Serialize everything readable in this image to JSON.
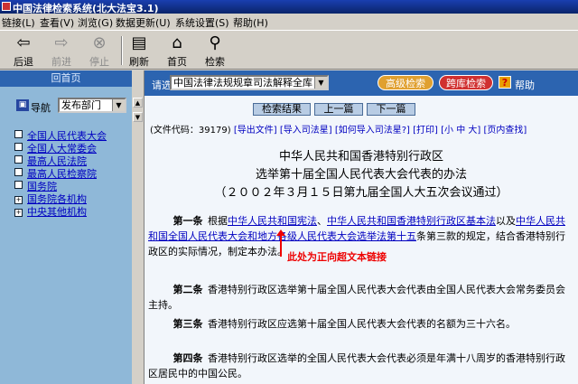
{
  "window": {
    "title": "中国法律检索系统(北大法宝3.1)"
  },
  "menu": [
    "链接(L)",
    "查看(V)",
    "浏览(G)",
    "数据更新(U)",
    "系统设置(S)",
    "帮助(H)"
  ],
  "toolbar": {
    "back": "后退",
    "forward": "前进",
    "stop": "停止",
    "refresh": "刷新",
    "home": "首页",
    "search": "检索"
  },
  "left": {
    "home_label": "回首页",
    "nav_label": "导航",
    "nav_select": "发布部门",
    "tree": [
      "全国人民代表大会",
      "全国人大常委会",
      "最高人民法院",
      "最高人民检察院",
      "国务院",
      "国务院各机构",
      "中央其他机构"
    ]
  },
  "query": {
    "label": "请选择",
    "select_value": "中国法律法规规章司法解释全库",
    "advanced": "高级检索",
    "cross": "跨库检索",
    "help": "帮助"
  },
  "doc": {
    "result_btn": "检索结果",
    "prev_btn": "上一篇",
    "next_btn": "下一篇",
    "code_text": "(文件代码：39179)",
    "links": [
      "[导出文件]",
      "[导入司法星]",
      "[如何导入司法星?]",
      "[打印]",
      "[小 中 大]",
      "[页内查找]"
    ],
    "title1": "中华人民共和国香港特别行政区",
    "title2": "选举第十届全国人民代表大会代表的办法",
    "title3": "（２００２年３月１５日第九届全国人大五次会议通过）",
    "a1_label": "第一条",
    "a1_pre": "根据",
    "a1_link1": "中华人民共和国宪法",
    "a1_sep1": "、",
    "a1_link2": "中华人民共和国香港特别行政区基本法",
    "a1_mid": "以及",
    "a1_link3": "中华人民共和国全国人民代表大会和地方各级人民代表大会选举法",
    "a1_link4": "第十五",
    "a1_post": "条第三款的规定，结合香港特别行政区的实际情况，制定本办法。",
    "annotation": "此处为正向超文本链接",
    "a2_label": "第二条",
    "a2_text": "香港特别行政区选举第十届全国人民代表大会代表由全国人民代表大会常务委员会主持。",
    "a3_label": "第三条",
    "a3_text": "香港特别行政区应选第十届全国人民代表大会代表的名额为三十六名。",
    "a4_label": "第四条",
    "a4_text": "香港特别行政区选举的全国人民代表大会代表必须是年满十八周岁的香港特别行政区居民中的中国公民。"
  },
  "colors": {
    "left_bg": "#8fb8d8",
    "bar": "#2c64b0",
    "advanced": "#e0a030",
    "cross": "#d03030"
  }
}
